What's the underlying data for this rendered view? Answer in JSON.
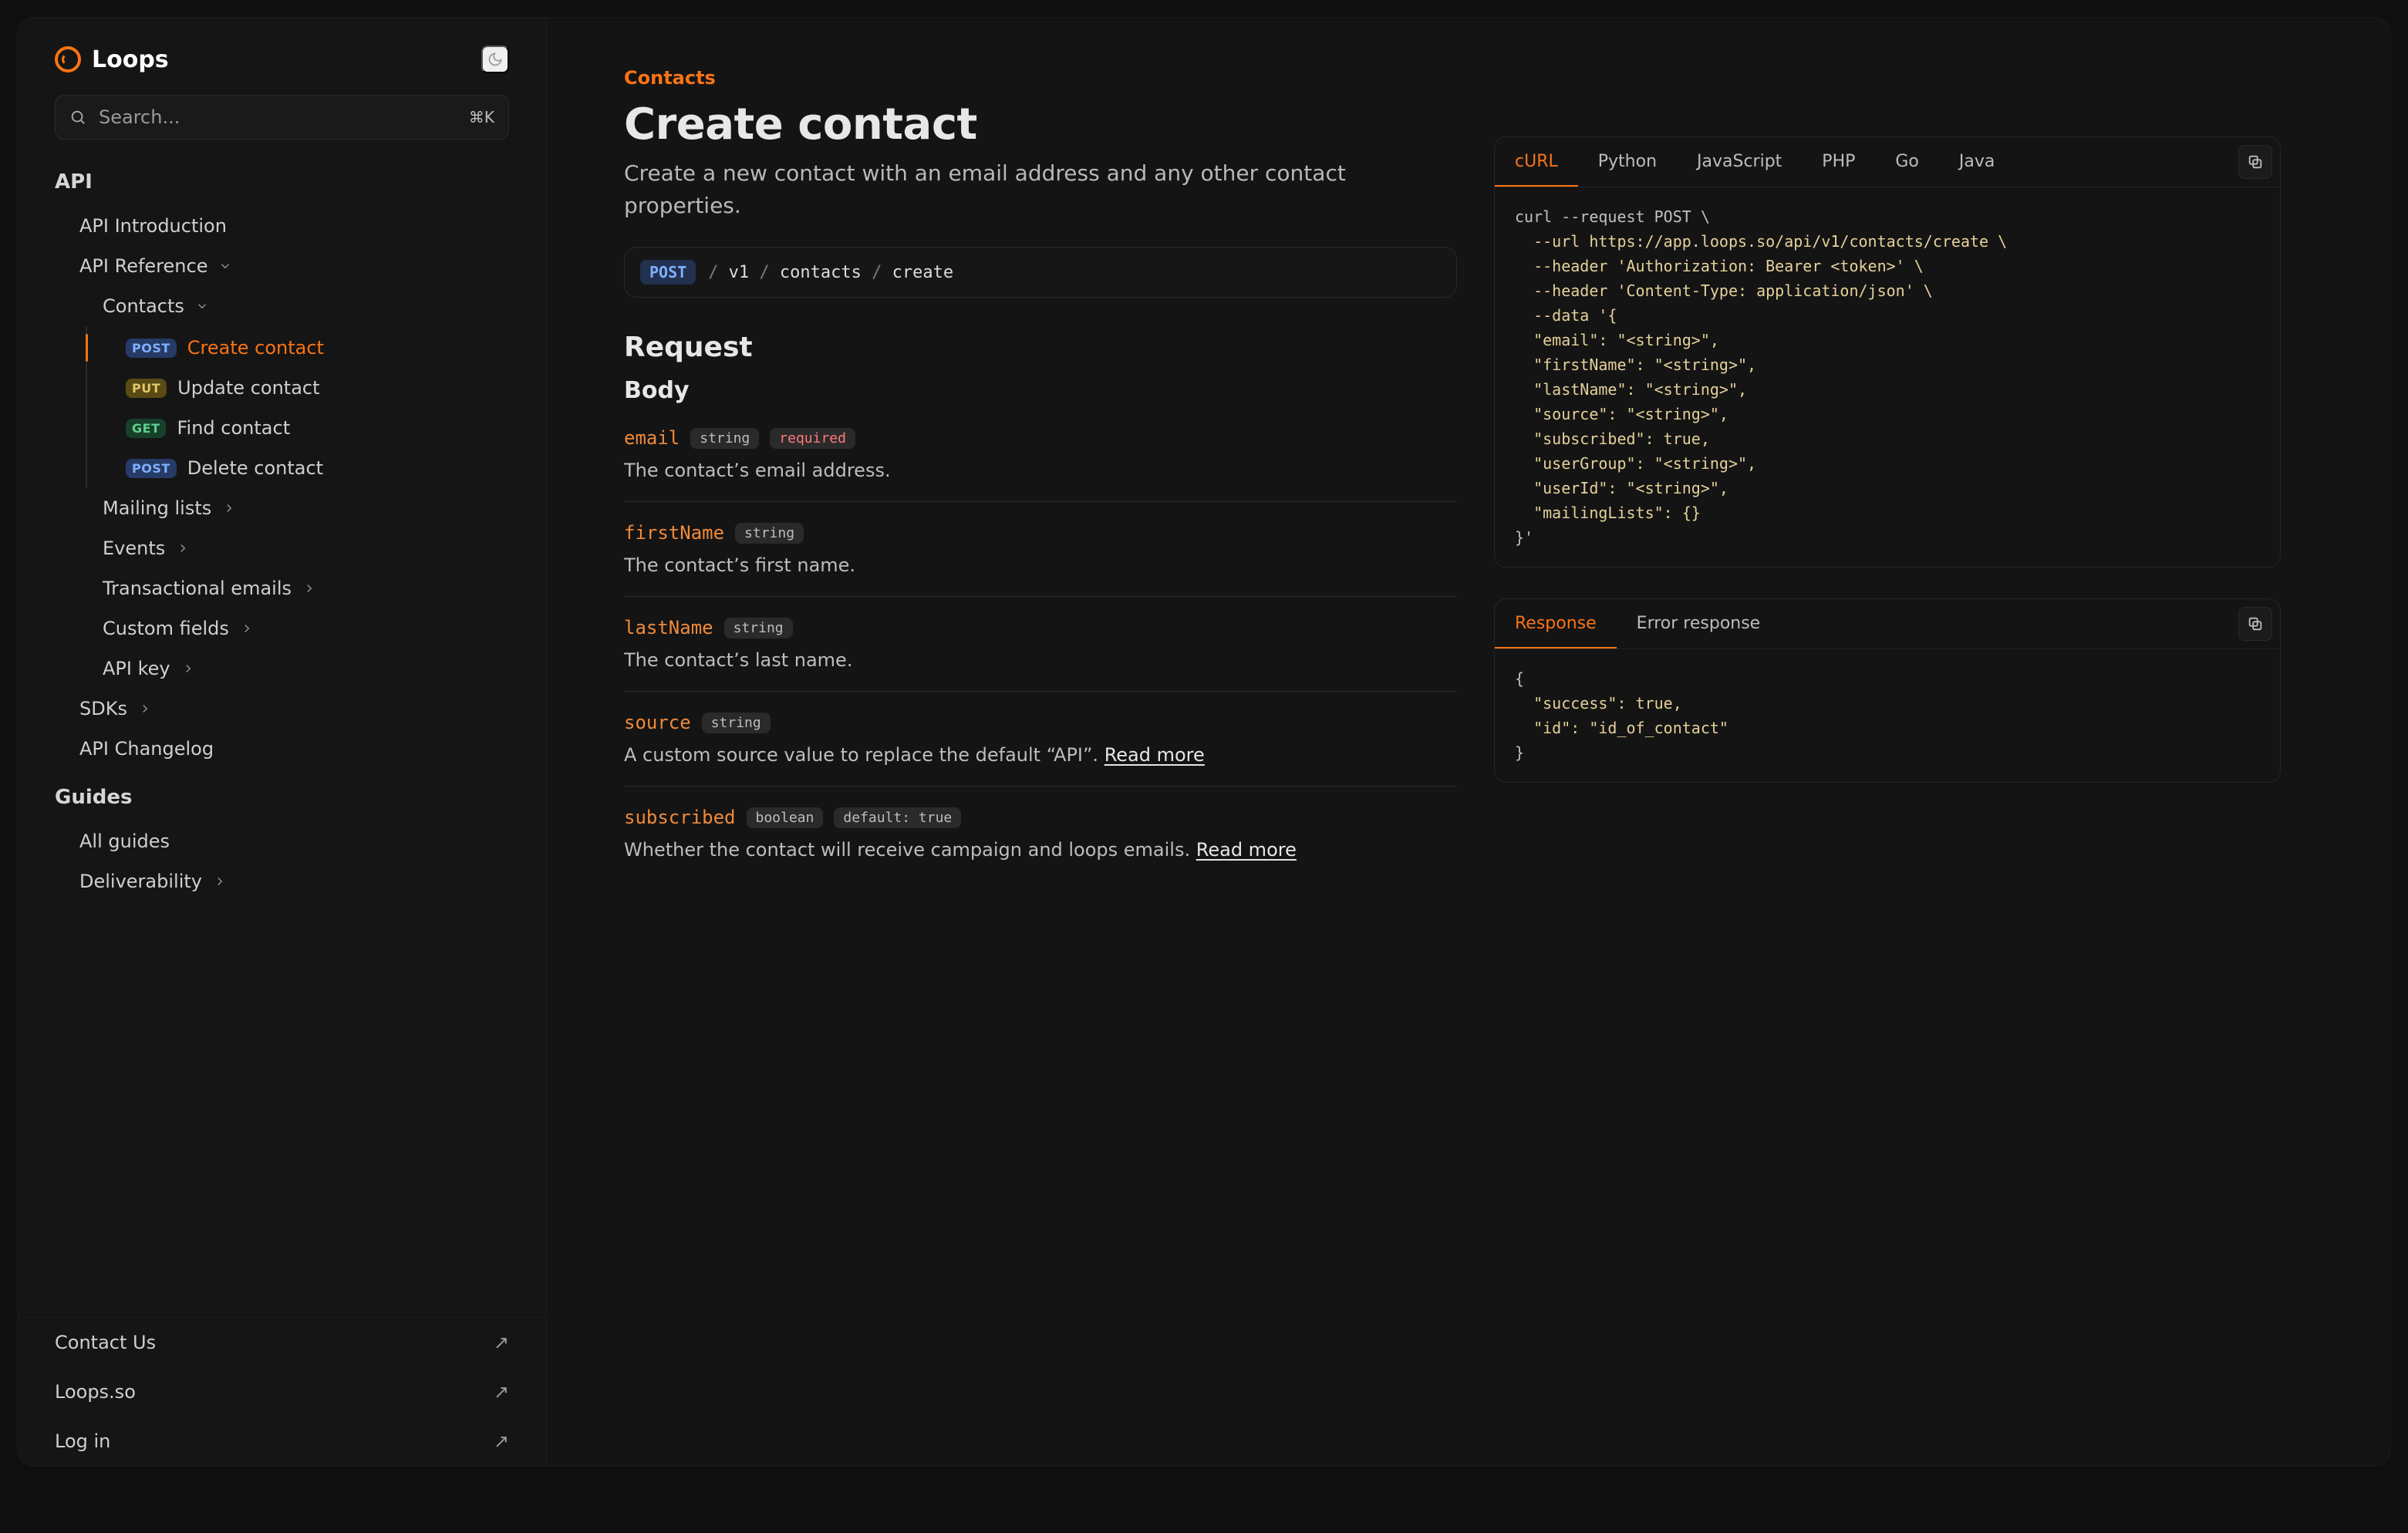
{
  "brand": {
    "name": "Loops"
  },
  "search": {
    "placeholder": "Search...",
    "shortcut": "⌘K"
  },
  "sections": {
    "api_title": "API",
    "guides_title": "Guides"
  },
  "nav": {
    "intro": "API Introduction",
    "reference": "API Reference",
    "contacts": "Contacts",
    "create": "Create contact",
    "update": "Update contact",
    "find": "Find contact",
    "delete": "Delete contact",
    "mailing": "Mailing lists",
    "events": "Events",
    "tx": "Transactional emails",
    "cfields": "Custom fields",
    "apikey": "API key",
    "sdks": "SDKs",
    "changelog": "API Changelog",
    "all_guides": "All guides",
    "deliverability": "Deliverability"
  },
  "footer": {
    "contact": "Contact Us",
    "site": "Loops.so",
    "login": "Log in"
  },
  "badges": {
    "post": "POST",
    "put": "PUT",
    "get": "GET"
  },
  "page": {
    "breadcrumb": "Contacts",
    "title": "Create contact",
    "subtitle": "Create a new contact with an email address and any other contact properties.",
    "method": "POST",
    "path_segments": [
      "v1",
      "contacts",
      "create"
    ],
    "request_title": "Request",
    "body_title": "Body"
  },
  "fields": [
    {
      "name": "email",
      "type": "string",
      "required": true,
      "desc": "The contact’s email address."
    },
    {
      "name": "firstName",
      "type": "string",
      "required": false,
      "desc": "The contact’s first name."
    },
    {
      "name": "lastName",
      "type": "string",
      "required": false,
      "desc": "The contact’s last name."
    },
    {
      "name": "source",
      "type": "string",
      "required": false,
      "desc": "A custom source value to replace the default “API”. ",
      "link": "Read more"
    },
    {
      "name": "subscribed",
      "type": "boolean",
      "required": false,
      "default": "default: true",
      "desc": "Whether the contact will receive campaign and loops emails. ",
      "link": "Read more"
    }
  ],
  "code_tabs": [
    "cURL",
    "Python",
    "JavaScript",
    "PHP",
    "Go",
    "Java"
  ],
  "response_tabs": [
    "Response",
    "Error response"
  ],
  "curl": {
    "l1": "curl --request POST \\",
    "l2": "  --url https://app.loops.so/api/v1/contacts/create \\",
    "l3": "  --header 'Authorization: Bearer <token>' \\",
    "l4": "  --header 'Content-Type: application/json' \\",
    "l5": "  --data '{",
    "l6": "  \"email\": \"<string>\",",
    "l7": "  \"firstName\": \"<string>\",",
    "l8": "  \"lastName\": \"<string>\",",
    "l9": "  \"source\": \"<string>\",",
    "l10": "  \"subscribed\": true,",
    "l11": "  \"userGroup\": \"<string>\",",
    "l12": "  \"userId\": \"<string>\",",
    "l13": "  \"mailingLists\": {}",
    "l14": "}'"
  },
  "response": {
    "l1": "{",
    "l2": "  \"success\": true,",
    "l3": "  \"id\": \"id_of_contact\"",
    "l4": "}"
  }
}
